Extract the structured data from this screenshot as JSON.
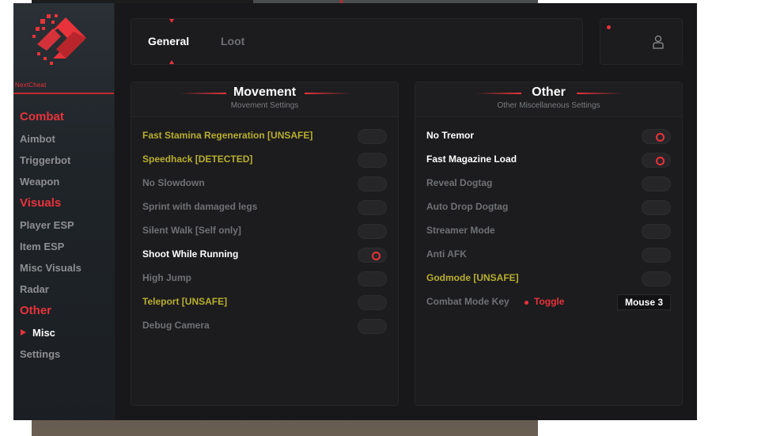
{
  "brand": {
    "name": "NextCheat",
    "accent": "#e8333b"
  },
  "sidebar": {
    "categories": [
      {
        "label": "Combat",
        "items": [
          {
            "label": "Aimbot"
          },
          {
            "label": "Triggerbot"
          },
          {
            "label": "Weapon"
          }
        ]
      },
      {
        "label": "Visuals",
        "items": [
          {
            "label": "Player ESP"
          },
          {
            "label": "Item ESP"
          },
          {
            "label": "Misc Visuals"
          },
          {
            "label": "Radar"
          }
        ]
      },
      {
        "label": "Other",
        "items": [
          {
            "label": "Misc",
            "active": true
          },
          {
            "label": "Settings"
          }
        ]
      }
    ]
  },
  "tabs": [
    {
      "label": "General",
      "active": true
    },
    {
      "label": "Loot",
      "active": false
    }
  ],
  "user": {
    "icon": "user-icon"
  },
  "movement": {
    "title": "Movement",
    "subtitle": "Movement Settings",
    "rows": [
      {
        "label": "Fast Stamina Regeneration [UNSAFE]",
        "state": "warn",
        "on": false
      },
      {
        "label": "Speedhack [DETECTED]",
        "state": "warn",
        "on": false
      },
      {
        "label": "No Slowdown",
        "state": "off",
        "on": false
      },
      {
        "label": "Sprint with damaged legs",
        "state": "off",
        "on": false
      },
      {
        "label": "Silent Walk [Self only]",
        "state": "off",
        "on": false
      },
      {
        "label": "Shoot While Running",
        "state": "on",
        "on": true
      },
      {
        "label": "High Jump",
        "state": "off",
        "on": false
      },
      {
        "label": "Teleport [UNSAFE]",
        "state": "warn",
        "on": false
      },
      {
        "label": "Debug Camera",
        "state": "off",
        "on": false
      }
    ]
  },
  "other": {
    "title": "Other",
    "subtitle": "Other Miscellaneous Settings",
    "rows": [
      {
        "label": "No Tremor",
        "state": "on",
        "on": true
      },
      {
        "label": "Fast Magazine Load",
        "state": "on",
        "on": true
      },
      {
        "label": "Reveal Dogtag",
        "state": "off",
        "on": false
      },
      {
        "label": "Auto Drop Dogtag",
        "state": "off",
        "on": false
      },
      {
        "label": "Streamer Mode",
        "state": "off",
        "on": false
      },
      {
        "label": "Anti AFK",
        "state": "off",
        "on": false
      },
      {
        "label": "Godmode [UNSAFE]",
        "state": "warn",
        "on": false
      }
    ],
    "keybind": {
      "label": "Combat Mode Key",
      "mode": "Toggle",
      "key": "Mouse 3"
    }
  }
}
